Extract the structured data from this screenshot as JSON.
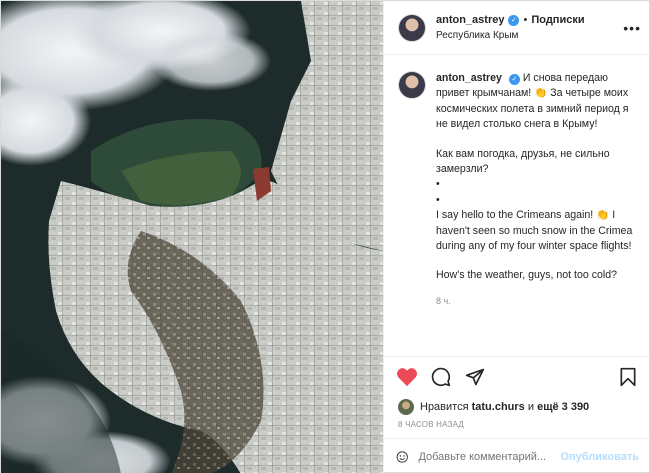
{
  "header": {
    "username": "anton_astrey",
    "separator": "•",
    "follow_label": "Подписки",
    "location": "Республика Крым",
    "more_label": "•••"
  },
  "caption": {
    "username": "anton_astrey",
    "text_ru_1": "И снова передаю привет крымчанам! 👏 За четыре моих космических полета в зимний период я не видел столько снега в Крыму!",
    "text_ru_2": "Как вам погодка, друзья, не сильно замерзли?",
    "bullet_1": "•",
    "bullet_2": "•",
    "text_en_1": "I say hello to the Crimeans again! 👏 I haven't seen so much snow in the Crimea during any of my four winter space flights!",
    "text_en_2": "How's the weather, guys, not too cold?",
    "time": "8 ч."
  },
  "actions": {
    "like_icon": "heart-filled-icon",
    "comment_icon": "comment-icon",
    "share_icon": "send-icon",
    "save_icon": "bookmark-icon"
  },
  "likes": {
    "prefix": "Нравится",
    "user": "tatu.churs",
    "and": "и",
    "more": "ещё 3 390"
  },
  "date": "8 часов назад",
  "add_comment": {
    "placeholder": "Добавьте комментарий...",
    "publish_label": "Опубликовать"
  },
  "colors": {
    "like_red": "#ed4956",
    "verified_blue": "#3897f0",
    "publish_disabled": "#b2dffc"
  }
}
